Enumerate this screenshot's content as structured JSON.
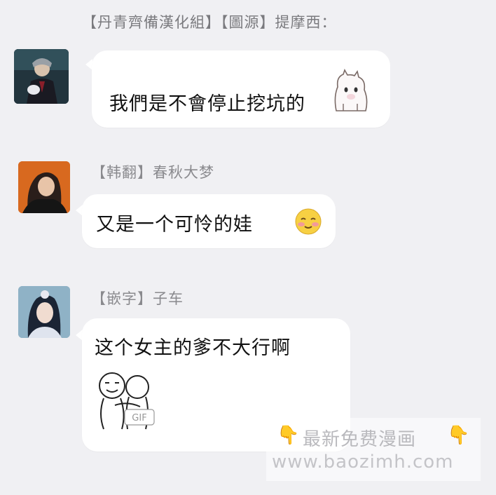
{
  "header": {
    "text": "【丹青齊備漢化組】【圖源】提摩西："
  },
  "messages": [
    {
      "sender": "",
      "text": "我們是不會停止挖坑的",
      "sticker": "alpaca-sticker",
      "avatar": "avatar-suited-man"
    },
    {
      "sender": "【韩翻】春秋大梦",
      "text": "又是一个可怜的娃",
      "emoji": "blushing-face-emoji",
      "avatar": "avatar-dark-haired-girl"
    },
    {
      "sender": "【嵌字】子车",
      "text": "这个女主的爹不大行啊",
      "sticker_badge": "GIF",
      "avatar": "avatar-ancient-style-girl"
    }
  ],
  "watermark": {
    "title": "最新免费漫画",
    "url": "www.baozimh.com",
    "icon": "pointing-down-hand-icon"
  },
  "colors": {
    "background": "#f0f0f3",
    "bubble": "#ffffff",
    "sender": "#8a8a8e",
    "text": "#111111"
  }
}
